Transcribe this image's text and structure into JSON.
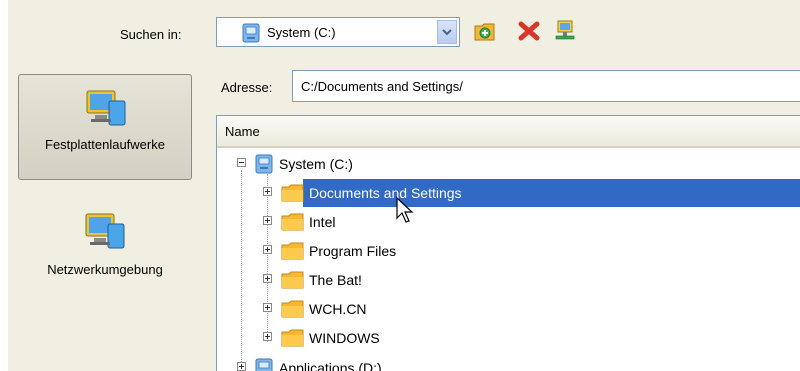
{
  "toolbar": {
    "look_in_label": "Suchen in:",
    "look_in_value": "System (C:)"
  },
  "places": [
    {
      "label": "Festplattenlaufwerke",
      "selected": true
    },
    {
      "label": "Netzwerkumgebung",
      "selected": false
    }
  ],
  "address": {
    "label": "Adresse:",
    "value": "C:/Documents and Settings/"
  },
  "tree": {
    "column_header": "Name",
    "root": "System (C:)",
    "folders": [
      {
        "label": "Documents and Settings",
        "selected": true
      },
      {
        "label": "Intel"
      },
      {
        "label": "Program Files"
      },
      {
        "label": "The Bat!"
      },
      {
        "label": "WCH.CN"
      },
      {
        "label": "WINDOWS"
      }
    ],
    "next_drive": "Applications (D:)"
  },
  "colors": {
    "dialog_bg": "#f1efe2",
    "selection": "#316ac5",
    "border": "#7f9db9",
    "folder": "#f5b830"
  }
}
